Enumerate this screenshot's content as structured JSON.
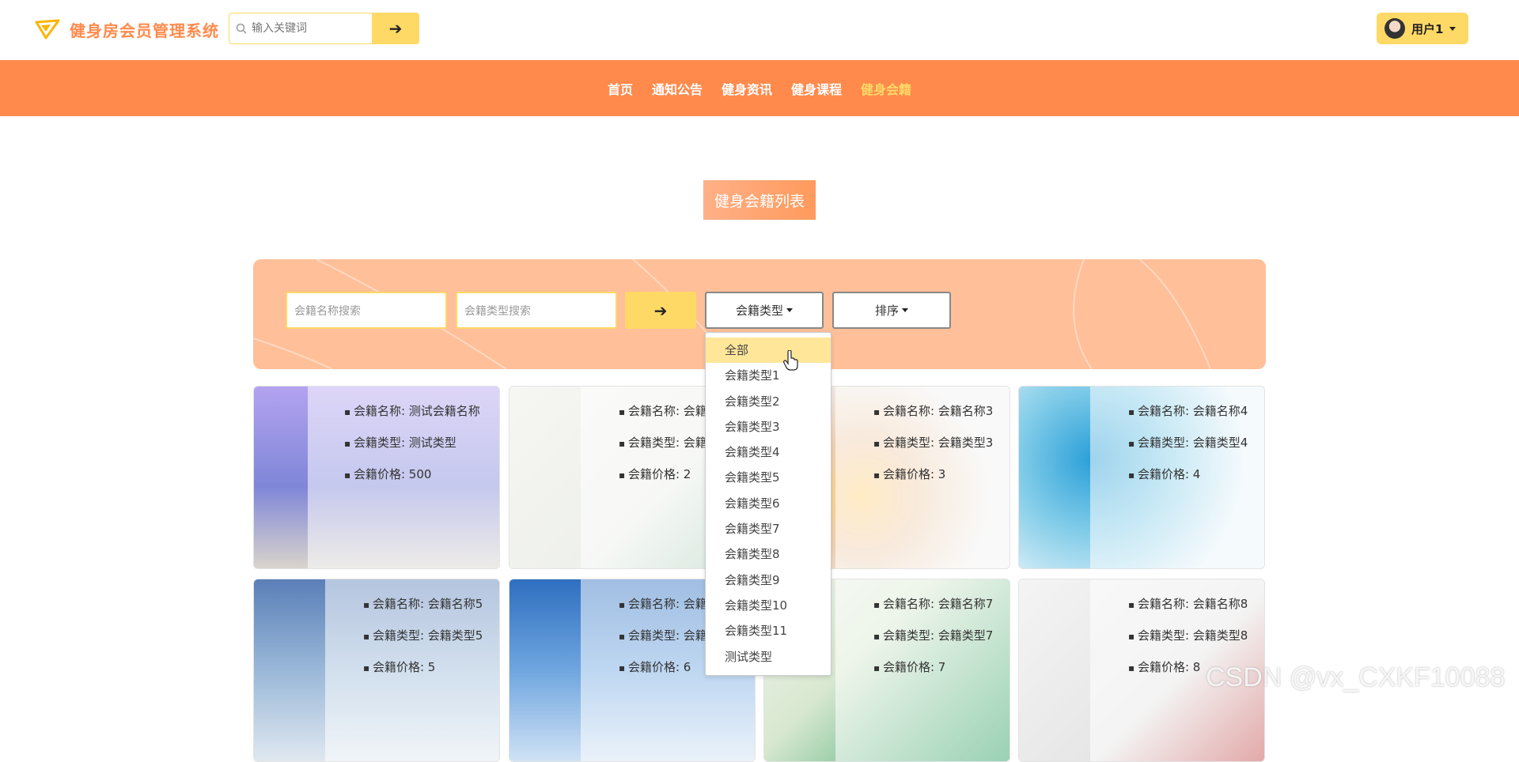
{
  "header": {
    "title": "健身房会员管理系统",
    "search_placeholder": "输入关键词",
    "search_button": "➔",
    "user_name": "用户1"
  },
  "nav": {
    "items": [
      "首页",
      "通知公告",
      "健身资讯",
      "健身课程",
      "健身会籍"
    ],
    "active": "健身会籍"
  },
  "section_title": "健身会籍列表",
  "filters": {
    "name_placeholder": "会籍名称搜索",
    "type_placeholder": "会籍类型搜索",
    "search_button": "➔",
    "type_dropdown": "会籍类型",
    "sort_dropdown": "排序"
  },
  "dropdown": {
    "items": [
      "全部",
      "会籍类型1",
      "会籍类型2",
      "会籍类型3",
      "会籍类型4",
      "会籍类型5",
      "会籍类型6",
      "会籍类型7",
      "会籍类型8",
      "会籍类型9",
      "会籍类型10",
      "会籍类型11",
      "测试类型"
    ],
    "highlighted": "全部"
  },
  "cards": [
    {
      "name": "会籍名称: 测试会籍名称",
      "type": "会籍类型: 测试类型",
      "price": "会籍价格: 500"
    },
    {
      "name": "会籍名称: 会籍名称2",
      "type": "会籍类型: 会籍类型2",
      "price": "会籍价格: 2"
    },
    {
      "name": "会籍名称: 会籍名称3",
      "type": "会籍类型: 会籍类型3",
      "price": "会籍价格: 3"
    },
    {
      "name": "会籍名称: 会籍名称4",
      "type": "会籍类型: 会籍类型4",
      "price": "会籍价格: 4"
    },
    {
      "name": "会籍名称: 会籍名称5",
      "type": "会籍类型: 会籍类型5",
      "price": "会籍价格: 5"
    },
    {
      "name": "会籍名称: 会籍名称6",
      "type": "会籍类型: 会籍类型6",
      "price": "会籍价格: 6"
    },
    {
      "name": "会籍名称: 会籍名称7",
      "type": "会籍类型: 会籍类型7",
      "price": "会籍价格: 7"
    },
    {
      "name": "会籍名称: 会籍名称8",
      "type": "会籍类型: 会籍类型8",
      "price": "会籍价格: 8"
    }
  ],
  "watermark": "CSDN @vx_CXKF10088",
  "colors": {
    "brand_orange": "#ff8a4c",
    "accent_yellow": "#ffd966",
    "panel_peach": "#ffbf99"
  }
}
